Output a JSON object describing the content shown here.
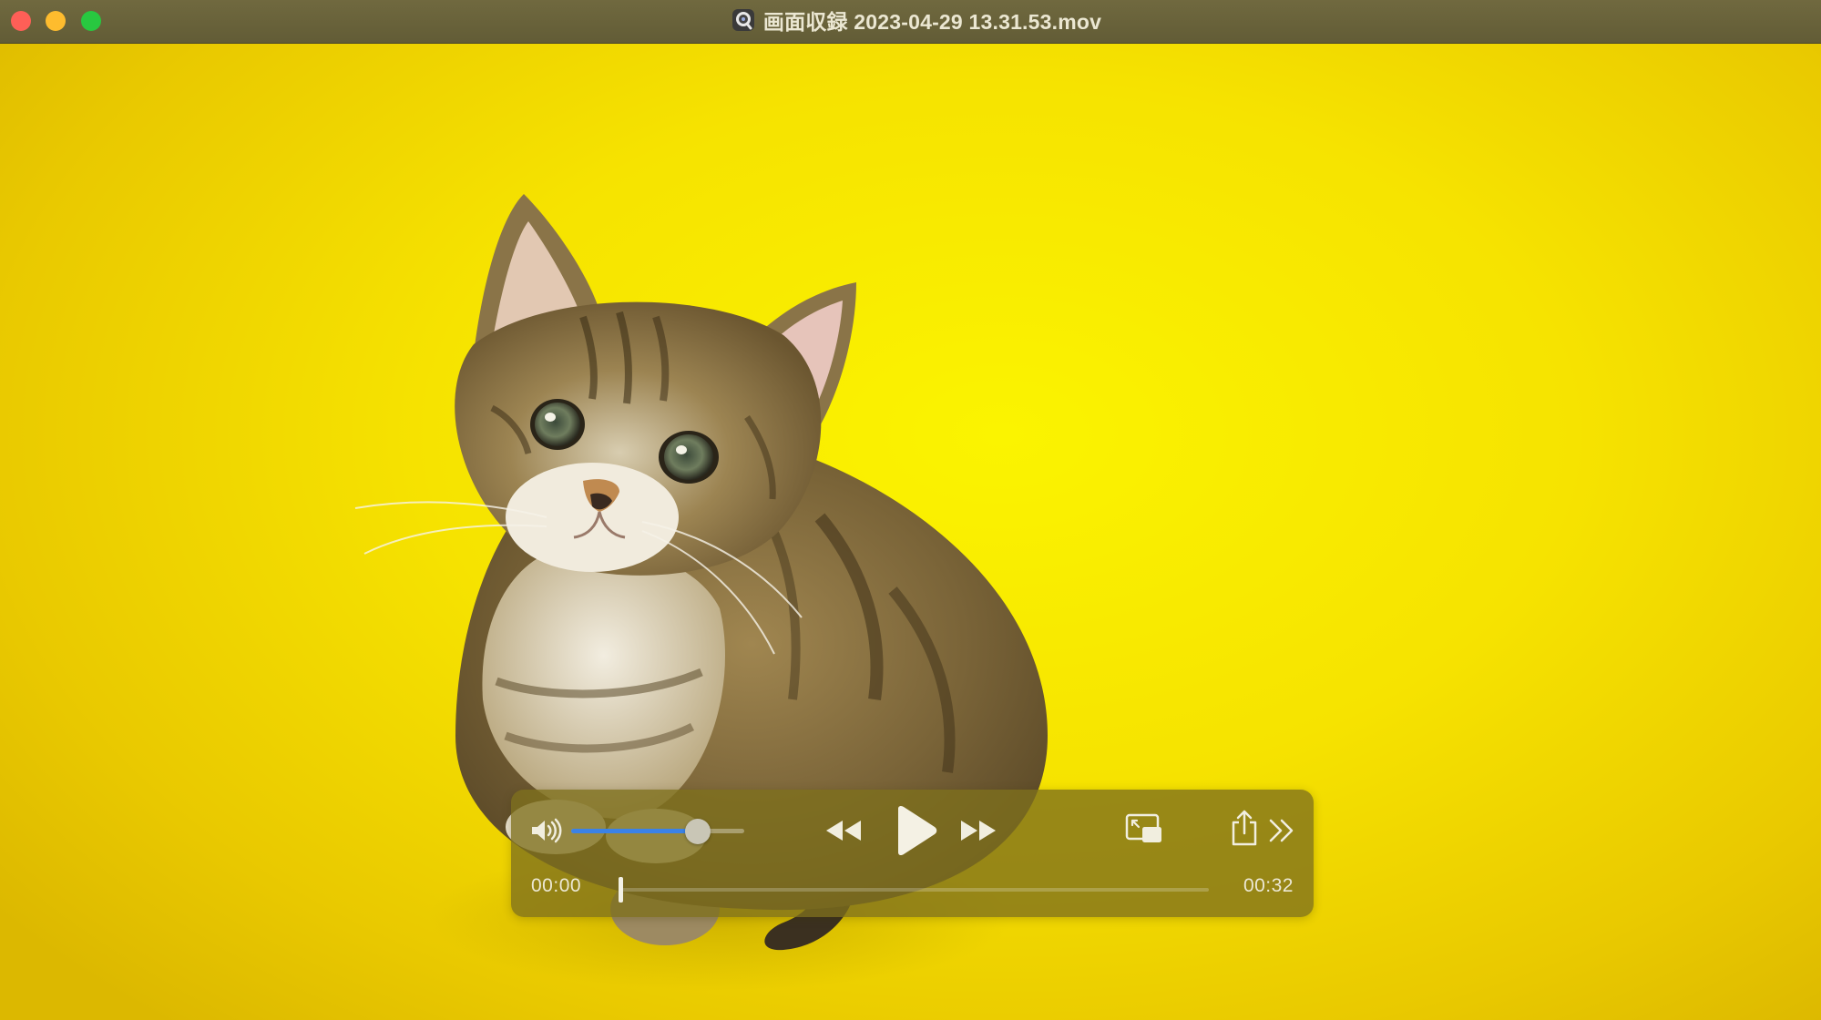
{
  "window": {
    "title": "画面収録 2023-04-29 13.31.53.mov",
    "traffic_lights": {
      "close_color": "#fe5f57",
      "minimize_color": "#febc2e",
      "zoom_color": "#28c840"
    },
    "document_icon": "quicktime-document-icon"
  },
  "video": {
    "background_color": "#f6e300",
    "subject": "kitten"
  },
  "controls": {
    "volume_icon": "speaker-icon",
    "volume_level": 0.73,
    "volume_accent_color": "#3b82e6",
    "rewind_icon": "rewind-icon",
    "play_icon": "play-icon",
    "fast_forward_icon": "fast-forward-icon",
    "pip_icon": "picture-in-picture-icon",
    "share_icon": "share-icon",
    "more_icon": "chevron-double-right-icon",
    "elapsed_time": "00:00",
    "remaining_time": "00:32",
    "progress": 0.0
  }
}
